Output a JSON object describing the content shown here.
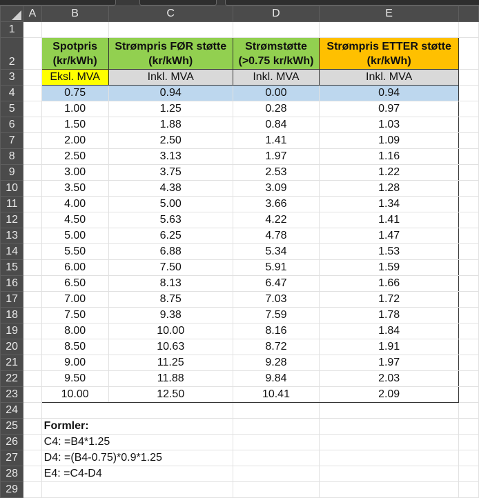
{
  "columns": [
    "A",
    "B",
    "C",
    "D",
    "E"
  ],
  "headers": {
    "B": [
      "Spotpris",
      "(kr/kWh)"
    ],
    "C": [
      "Strømpris FØR støtte",
      "(kr/kWh)"
    ],
    "D": [
      "Strømstøtte",
      "(>0.75 kr/kWh)"
    ],
    "E": [
      "Strømpris ETTER støtte",
      "(kr/kWh)"
    ]
  },
  "subheaders": {
    "B": "Eksl. MVA",
    "C": "Inkl. MVA",
    "D": "Inkl. MVA",
    "E": "Inkl. MVA"
  },
  "rows": [
    [
      "0.75",
      "0.94",
      "0.00",
      "0.94"
    ],
    [
      "1.00",
      "1.25",
      "0.28",
      "0.97"
    ],
    [
      "1.50",
      "1.88",
      "0.84",
      "1.03"
    ],
    [
      "2.00",
      "2.50",
      "1.41",
      "1.09"
    ],
    [
      "2.50",
      "3.13",
      "1.97",
      "1.16"
    ],
    [
      "3.00",
      "3.75",
      "2.53",
      "1.22"
    ],
    [
      "3.50",
      "4.38",
      "3.09",
      "1.28"
    ],
    [
      "4.00",
      "5.00",
      "3.66",
      "1.34"
    ],
    [
      "4.50",
      "5.63",
      "4.22",
      "1.41"
    ],
    [
      "5.00",
      "6.25",
      "4.78",
      "1.47"
    ],
    [
      "5.50",
      "6.88",
      "5.34",
      "1.53"
    ],
    [
      "6.00",
      "7.50",
      "5.91",
      "1.59"
    ],
    [
      "6.50",
      "8.13",
      "6.47",
      "1.66"
    ],
    [
      "7.00",
      "8.75",
      "7.03",
      "1.72"
    ],
    [
      "7.50",
      "9.38",
      "7.59",
      "1.78"
    ],
    [
      "8.00",
      "10.00",
      "8.16",
      "1.84"
    ],
    [
      "8.50",
      "10.63",
      "8.72",
      "1.91"
    ],
    [
      "9.00",
      "11.25",
      "9.28",
      "1.97"
    ],
    [
      "9.50",
      "11.88",
      "9.84",
      "2.03"
    ],
    [
      "10.00",
      "12.50",
      "10.41",
      "2.09"
    ]
  ],
  "formulas": {
    "title": "Formler:",
    "lines": [
      "C4: =B4*1.25",
      "D4: =(B4-0.75)*0.9*1.25",
      "E4: =C4-D4"
    ]
  },
  "colors": {
    "green": "#92d050",
    "orange": "#ffc000",
    "yellow": "#ffff00",
    "gray": "#d9d9d9",
    "selected_row": "#bdd7ee"
  }
}
